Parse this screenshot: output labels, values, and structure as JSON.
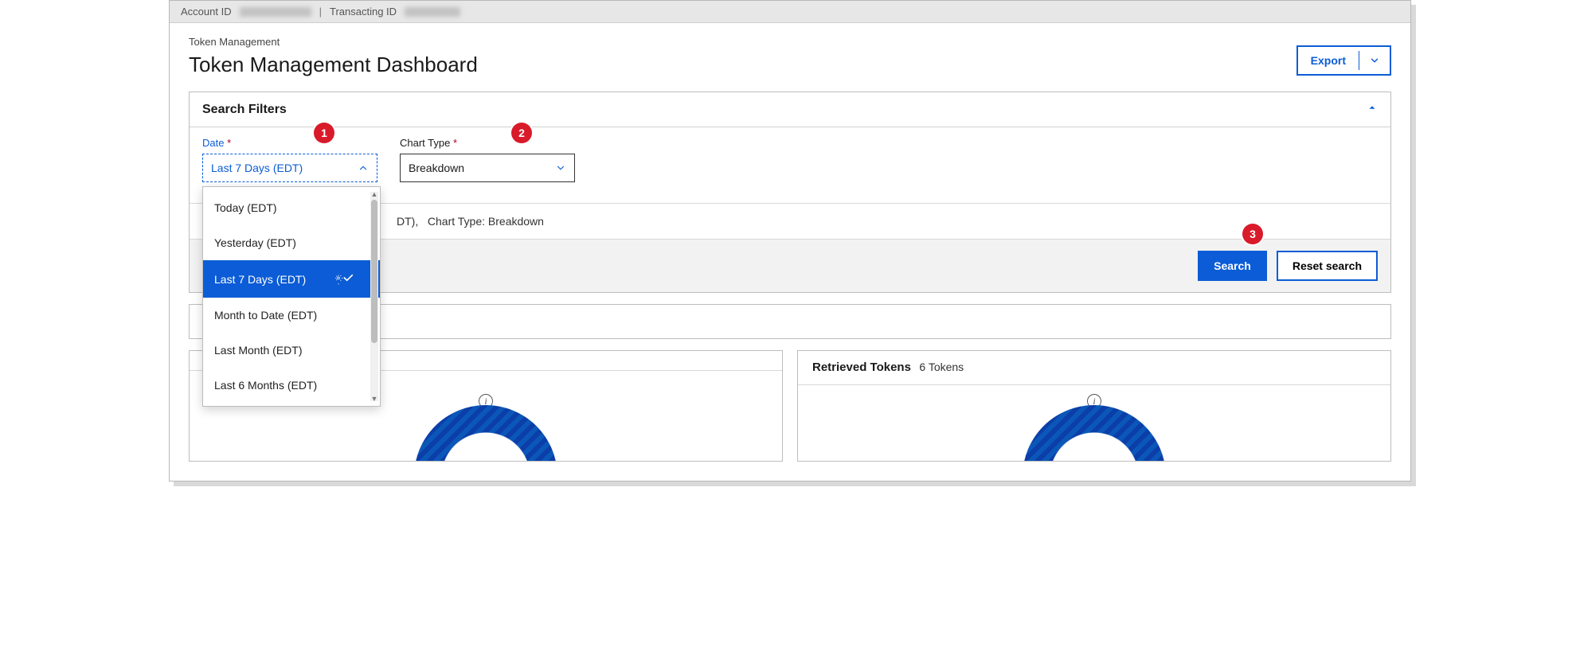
{
  "topbar": {
    "account_label": "Account ID",
    "transacting_label": "Transacting ID"
  },
  "header": {
    "breadcrumb": "Token Management",
    "title": "Token Management Dashboard",
    "export_label": "Export"
  },
  "filters": {
    "panel_title": "Search Filters",
    "date": {
      "label": "Date",
      "selected": "Last 7 Days (EDT)",
      "options": [
        "Today (EDT)",
        "Yesterday (EDT)",
        "Last 7 Days (EDT)",
        "Month to Date (EDT)",
        "Last Month (EDT)",
        "Last 6 Months (EDT)"
      ]
    },
    "chart_type": {
      "label": "Chart Type",
      "selected": "Breakdown"
    },
    "summary": {
      "date_suffix": "DT),",
      "chart_key": "Chart Type",
      "chart_val": "Breakdown"
    },
    "actions": {
      "search": "Search",
      "reset": "Reset search"
    }
  },
  "cards": {
    "retrieved": {
      "title": "Retrieved Tokens",
      "subtitle": "6 Tokens"
    }
  },
  "callouts": {
    "one": "1",
    "two": "2",
    "three": "3"
  }
}
